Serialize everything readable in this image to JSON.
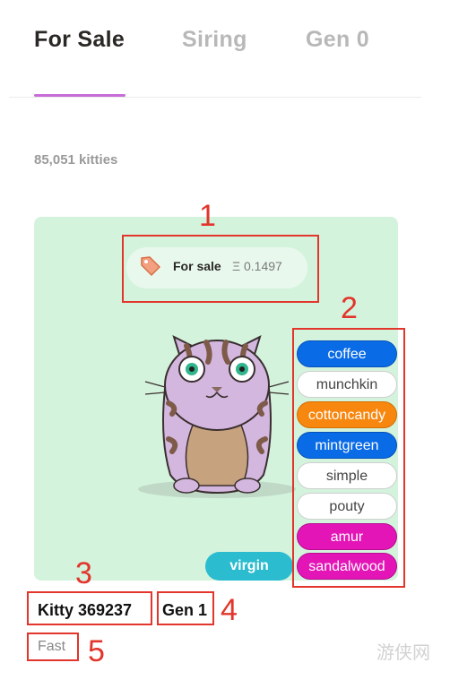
{
  "tabs": {
    "for_sale": "For Sale",
    "siring": "Siring",
    "gen0": "Gen 0"
  },
  "count_text": "85,051 kitties",
  "card": {
    "sale_label": "For sale",
    "price": "Ξ 0.1497",
    "cattributes": [
      "coffee",
      "munchkin",
      "cottoncandy",
      "mintgreen",
      "simple",
      "pouty",
      "amur",
      "sandalwood"
    ],
    "virgin_badge": "virgin",
    "name": "Kitty 369237",
    "separator": "·",
    "generation": "Gen 1",
    "speed": "Fast"
  },
  "annotations": [
    "1",
    "2",
    "3",
    "4",
    "5"
  ],
  "watermark": "游侠网",
  "colors": {
    "accent_underline": "#c86dd7",
    "card_bg": "#d4f3dd",
    "body_blue": "#0a6be6",
    "orange": "#f7870f",
    "pink": "#e415b6",
    "virgin_teal": "#2bbccf",
    "annotation_red": "#e2352b"
  }
}
